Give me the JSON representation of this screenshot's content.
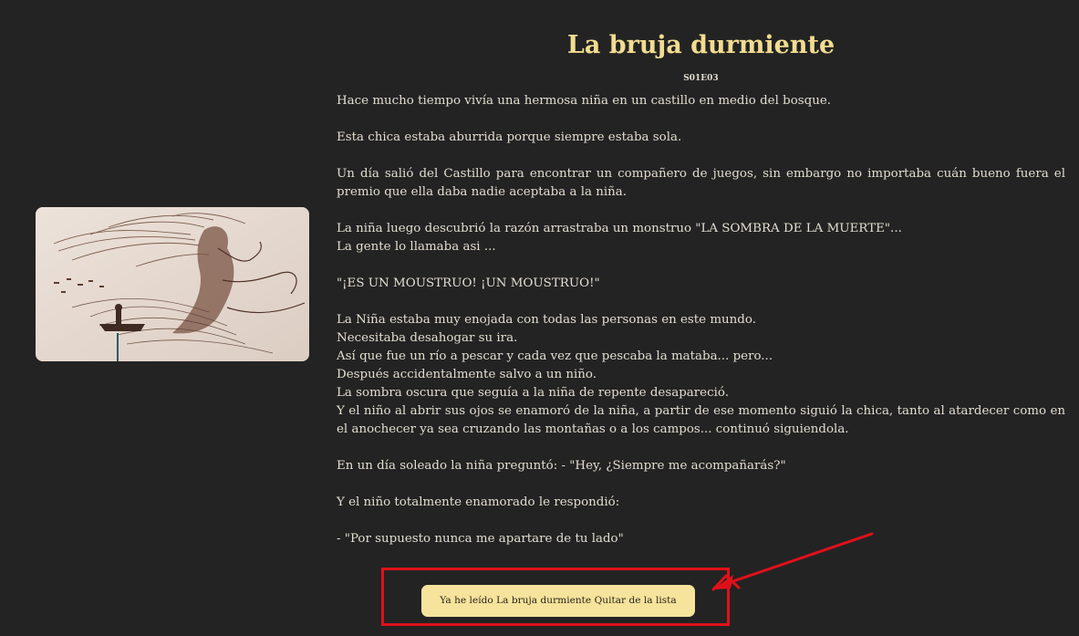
{
  "story": {
    "title": "La bruja durmiente",
    "episode": "S01E03",
    "paragraphs": [
      {
        "lines": [
          "Hace mucho tiempo vivía una hermosa niña en un castillo en medio del bosque."
        ]
      },
      {
        "lines": [
          "Esta chica estaba aburrida porque siempre estaba sola."
        ]
      },
      {
        "lines": [
          "Un día salió del Castillo para encontrar un compañero de juegos, sin embargo no importaba cuán bueno fuera el premio que ella daba nadie aceptaba a la niña."
        ]
      },
      {
        "lines": [
          "La niña luego descubrió la razón arrastraba un monstruo \"LA SOMBRA DE LA MUERTE\"...",
          "La gente lo llamaba asi ..."
        ]
      },
      {
        "lines": [
          "\"¡ES UN MOUSTRUO! ¡UN MOUSTRUO!\""
        ]
      },
      {
        "lines": [
          "La Niña estaba muy enojada con todas las personas en este mundo.",
          "Necesitaba desahogar su ira.",
          "Así que fue un río a pescar y cada vez que pescaba la mataba... pero...",
          "Después accidentalmente salvo a un niño.",
          "La sombra oscura que seguía a la niña de repente desapareció.",
          "Y el niño al abrir sus ojos se enamoró de la niña, a partir de ese momento siguió la chica, tanto al atardecer como en el anochecer ya sea cruzando las montañas o a los campos... continuó siguiendola."
        ]
      },
      {
        "lines": [
          "En un día soleado la niña preguntó: - \"Hey, ¿Siempre me acompañarás?\""
        ]
      },
      {
        "lines": [
          "Y el niño totalmente enamorado le respondió:"
        ]
      },
      {
        "lines": [
          "- \"Por supuesto nunca me apartare de tu lado\""
        ]
      }
    ],
    "illustration_icon": "witch-illustration"
  },
  "actions": {
    "mark_read_label": "Ya he leído La bruja durmiente Quitar de la lista"
  },
  "colors": {
    "background": "#232323",
    "title": "#f2dc90",
    "text": "#e2ddd0",
    "button_bg": "#f6e39c",
    "annotation": "#e0101a"
  }
}
